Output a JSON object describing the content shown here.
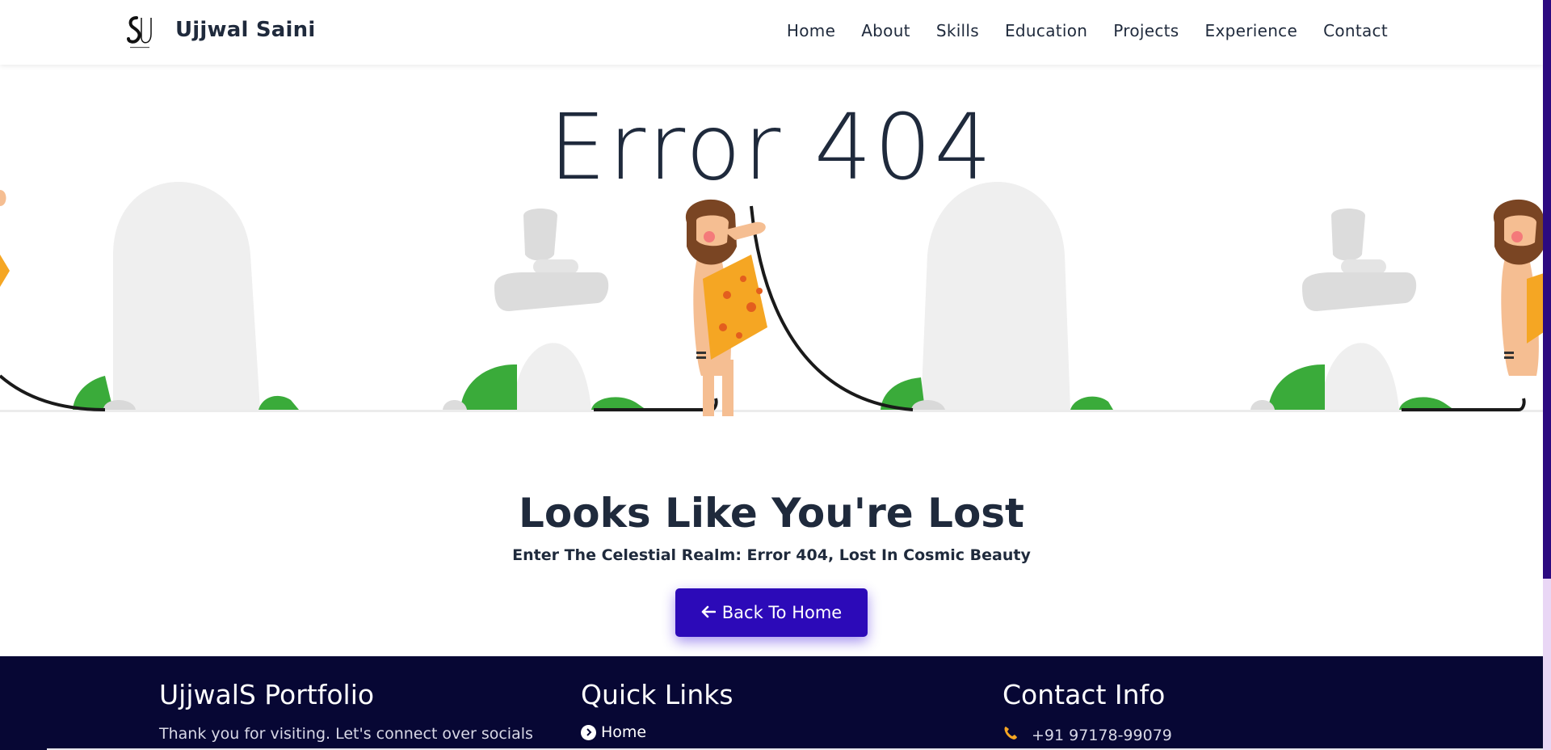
{
  "header": {
    "brand": "Ujjwal Saini",
    "logo_icon": "us-monogram-logo",
    "nav": [
      "Home",
      "About",
      "Skills",
      "Education",
      "Projects",
      "Experience",
      "Contact"
    ]
  },
  "hero": {
    "error_title": "Error 404",
    "illustration": "caveman-unplugged-cable-illustration"
  },
  "message": {
    "title": "Looks Like You're Lost",
    "subtitle": "Enter The Celestial Realm: Error 404, Lost In Cosmic Beauty",
    "button_label": "Back To Home",
    "button_icon": "arrow-left-icon"
  },
  "footer": {
    "col1_title": "UjjwalS Portfolio",
    "col1_text": "Thank you for visiting. Let's connect over socials",
    "col2_title": "Quick Links",
    "col2_first_link": "Home",
    "col3_title": "Contact Info",
    "phone": "+91 97178-99079",
    "phone_icon": "phone-icon"
  },
  "colors": {
    "accent": "#2c0ab8",
    "footer_bg": "#070734",
    "text_dark": "#1f2a3c",
    "phone_icon": "#f5a623",
    "scroll_thumb": "#2c0a80"
  }
}
